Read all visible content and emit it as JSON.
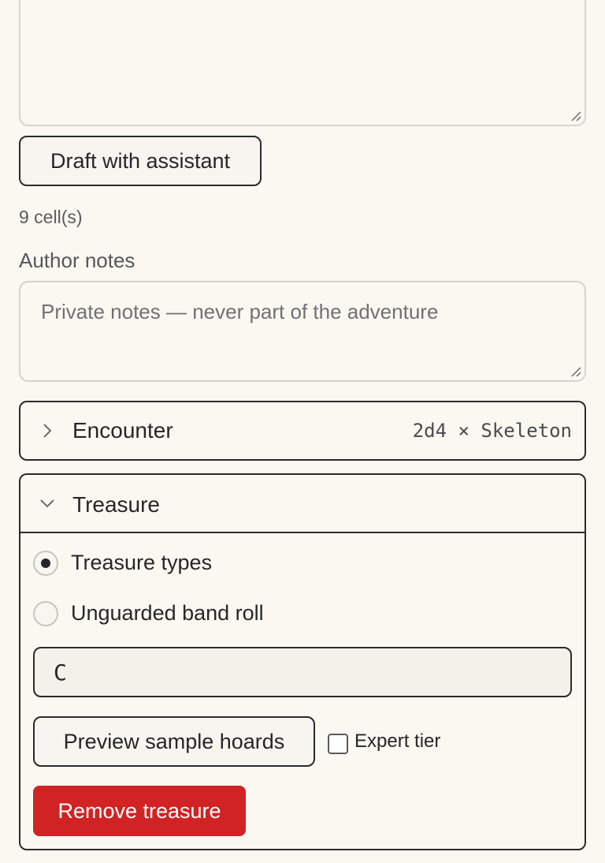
{
  "draft_button_label": "Draft with assistant",
  "cell_count": "9 cell(s)",
  "author_notes": {
    "label": "Author notes",
    "placeholder": "Private notes — never part of the adventure",
    "value": ""
  },
  "encounter": {
    "title": "Encounter",
    "summary": "2d4 × Skeleton",
    "expanded": false
  },
  "treasure": {
    "title": "Treasure",
    "expanded": true,
    "options": [
      {
        "label": "Treasure types",
        "selected": true
      },
      {
        "label": "Unguarded band roll",
        "selected": false
      }
    ],
    "type_value": "C",
    "preview_label": "Preview sample hoards",
    "expert_tier_label": "Expert tier",
    "expert_tier_checked": false,
    "remove_label": "Remove treasure"
  },
  "colors": {
    "background": "#fbf8f1",
    "danger": "#d12323",
    "border": "#2a2a2e"
  },
  "icons": {
    "collapsed": "chevron-right-icon",
    "expanded": "chevron-down-icon"
  }
}
